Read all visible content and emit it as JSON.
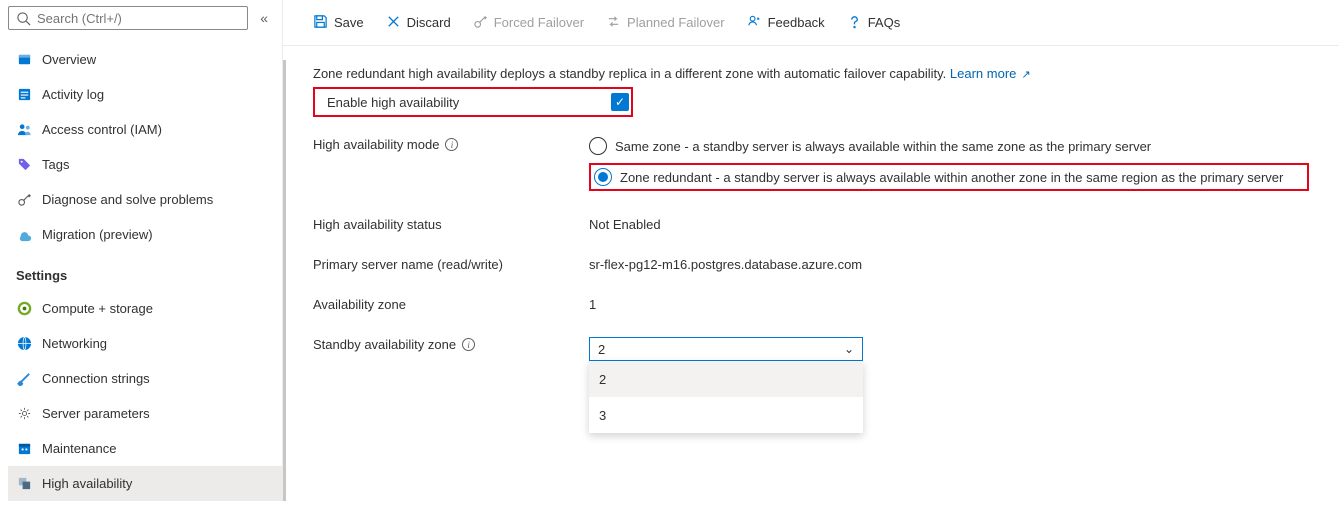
{
  "sidebar": {
    "search_placeholder": "Search (Ctrl+/)",
    "top_items": [
      {
        "icon": "overview-icon",
        "label": "Overview"
      },
      {
        "icon": "activitylog-icon",
        "label": "Activity log"
      },
      {
        "icon": "iam-icon",
        "label": "Access control (IAM)"
      },
      {
        "icon": "tags-icon",
        "label": "Tags"
      },
      {
        "icon": "diagnose-icon",
        "label": "Diagnose and solve problems"
      },
      {
        "icon": "migration-icon",
        "label": "Migration (preview)"
      }
    ],
    "settings_header": "Settings",
    "settings_items": [
      {
        "icon": "compute-icon",
        "label": "Compute + storage"
      },
      {
        "icon": "network-icon",
        "label": "Networking"
      },
      {
        "icon": "connstr-icon",
        "label": "Connection strings"
      },
      {
        "icon": "params-icon",
        "label": "Server parameters"
      },
      {
        "icon": "maint-icon",
        "label": "Maintenance"
      },
      {
        "icon": "ha-icon",
        "label": "High availability"
      }
    ]
  },
  "toolbar": {
    "save_label": "Save",
    "discard_label": "Discard",
    "forced_label": "Forced Failover",
    "planned_label": "Planned Failover",
    "feedback_label": "Feedback",
    "faqs_label": "FAQs"
  },
  "content": {
    "description": "Zone redundant high availability deploys a standby replica in a different zone with automatic failover capability. ",
    "learn_more": "Learn more",
    "enable_ha_label": "Enable high availability",
    "ha_mode_label": "High availability mode",
    "radio": {
      "same_zone": "Same zone - a standby server is always available within the same zone as the primary server",
      "zone_redundant": "Zone redundant - a standby server is always available within another zone in the same region as the primary server"
    },
    "status_label": "High availability status",
    "status_value": "Not Enabled",
    "primary_label": "Primary server name (read/write)",
    "primary_value": "sr-flex-pg12-m16.postgres.database.azure.com",
    "az_label": "Availability zone",
    "az_value": "1",
    "standby_az_label": "Standby availability zone",
    "dropdown": {
      "selected": "2",
      "options": [
        "2",
        "3"
      ]
    }
  }
}
